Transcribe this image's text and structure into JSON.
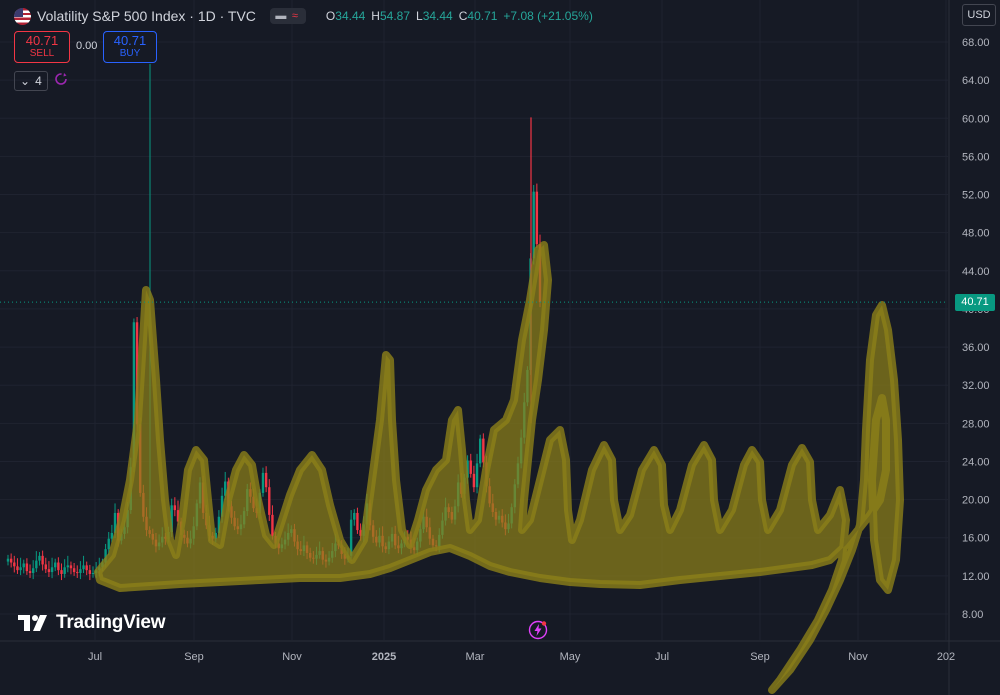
{
  "header": {
    "title": "Volatility S&P 500 Index · 1D · TVC",
    "ohlc": [
      {
        "k": "O",
        "v": "34.44"
      },
      {
        "k": "H",
        "v": "54.87"
      },
      {
        "k": "L",
        "v": "34.44"
      },
      {
        "k": "C",
        "v": "40.71"
      }
    ],
    "change": "+7.08 (+21.05%)"
  },
  "trade": {
    "sell_price": "40.71",
    "sell_label": "SELL",
    "spread": "0.00",
    "buy_price": "40.71",
    "buy_label": "BUY"
  },
  "indicators_count": "4",
  "currency": "USD",
  "last_price": "40.71",
  "branding": "TradingView",
  "colors": {
    "background": "#161a25",
    "up": "#089981",
    "down": "#f23645",
    "overlay": "#8c8019"
  },
  "chart_data": {
    "type": "candlestick",
    "y_ticks": [
      "68.00",
      "64.00",
      "60.00",
      "56.00",
      "52.00",
      "48.00",
      "44.00",
      "40.00",
      "36.00",
      "32.00",
      "28.00",
      "24.00",
      "20.00",
      "16.00",
      "12.00",
      "8.00"
    ],
    "x_ticks": [
      "Jul",
      "Sep",
      "Nov",
      "2025",
      "Mar",
      "May",
      "Jul",
      "Sep",
      "Nov",
      "202"
    ],
    "ylim": [
      5,
      70
    ],
    "last_close": 40.71,
    "series_close": [
      13.8,
      13.4,
      13.0,
      12.6,
      12.9,
      13.3,
      12.5,
      12.3,
      12.8,
      13.6,
      14.1,
      13.2,
      12.7,
      12.4,
      12.9,
      13.4,
      12.6,
      12.2,
      12.9,
      13.1,
      12.8,
      12.4,
      12.3,
      12.7,
      13.1,
      12.6,
      12.2,
      12.3,
      12.6,
      12.9,
      13.4,
      14.8,
      15.9,
      16.5,
      18.6,
      15.7,
      16.4,
      17.1,
      18.9,
      23.4,
      38.6,
      27.9,
      20.7,
      18.2,
      16.8,
      16.4,
      15.8,
      15.1,
      15.5,
      16.1,
      15.9,
      16.6,
      19.4,
      18.9,
      17.7,
      16.3,
      16.0,
      15.4,
      15.9,
      17.2,
      19.6,
      21.8,
      18.6,
      17.3,
      16.2,
      15.9,
      16.5,
      18.2,
      20.4,
      21.9,
      19.3,
      18.1,
      17.2,
      16.9,
      17.4,
      18.8,
      21.1,
      20.3,
      19.1,
      18.6,
      20.7,
      22.8,
      21.3,
      18.4,
      16.2,
      15.4,
      14.9,
      15.3,
      15.8,
      16.5,
      16.9,
      15.6,
      14.8,
      14.6,
      15.2,
      14.4,
      13.9,
      13.8,
      14.2,
      14.6,
      13.7,
      13.5,
      13.9,
      14.6,
      15.4,
      15.2,
      14.3,
      13.8,
      14.1,
      17.9,
      18.6,
      16.8,
      16.2,
      17.4,
      19.6,
      17.3,
      16.1,
      15.5,
      16.2,
      15.1,
      14.8,
      15.6,
      16.4,
      15.2,
      14.9,
      15.4,
      16.1,
      15.8,
      15.0,
      14.7,
      15.6,
      16.9,
      18.2,
      17.1,
      15.9,
      15.2,
      15.1,
      16.3,
      17.8,
      19.2,
      18.7,
      17.9,
      19.3,
      21.8,
      20.6,
      22.3,
      24.1,
      22.7,
      21.3,
      23.8,
      26.4,
      23.9,
      21.4,
      19.6,
      18.7,
      17.9,
      18.3,
      17.6,
      16.9,
      17.5,
      19.2,
      21.6,
      23.8,
      26.5,
      30.2,
      33.6,
      45.3,
      52.3,
      46.8,
      40.71
    ],
    "bar_x_start": 8,
    "bar_x_end": 540
  }
}
